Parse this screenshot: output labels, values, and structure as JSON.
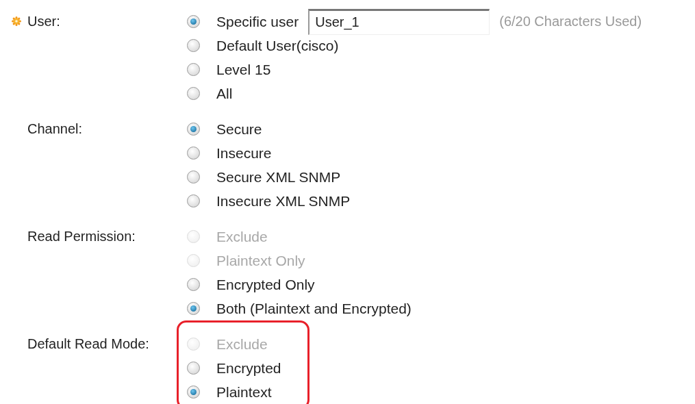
{
  "groups": [
    {
      "label": "User:",
      "required": true,
      "highlighted": false,
      "options": [
        {
          "label": "Specific user",
          "selected": true,
          "disabled": false,
          "input": {
            "value": "User_1",
            "hint": "(6/20 Characters Used)"
          }
        },
        {
          "label": "Default User(cisco)",
          "selected": false,
          "disabled": false
        },
        {
          "label": "Level 15",
          "selected": false,
          "disabled": false
        },
        {
          "label": "All",
          "selected": false,
          "disabled": false
        }
      ]
    },
    {
      "label": "Channel:",
      "required": false,
      "highlighted": false,
      "options": [
        {
          "label": "Secure",
          "selected": true,
          "disabled": false
        },
        {
          "label": "Insecure",
          "selected": false,
          "disabled": false
        },
        {
          "label": "Secure XML SNMP",
          "selected": false,
          "disabled": false
        },
        {
          "label": "Insecure XML SNMP",
          "selected": false,
          "disabled": false
        }
      ]
    },
    {
      "label": "Read Permission:",
      "required": false,
      "highlighted": false,
      "options": [
        {
          "label": "Exclude",
          "selected": false,
          "disabled": true
        },
        {
          "label": "Plaintext Only",
          "selected": false,
          "disabled": true
        },
        {
          "label": "Encrypted Only",
          "selected": false,
          "disabled": false
        },
        {
          "label": "Both (Plaintext and Encrypted)",
          "selected": true,
          "disabled": false
        }
      ]
    },
    {
      "label": "Default Read Mode:",
      "required": false,
      "highlighted": true,
      "options": [
        {
          "label": "Exclude",
          "selected": false,
          "disabled": true
        },
        {
          "label": "Encrypted",
          "selected": false,
          "disabled": false
        },
        {
          "label": "Plaintext",
          "selected": true,
          "disabled": false
        }
      ]
    }
  ]
}
